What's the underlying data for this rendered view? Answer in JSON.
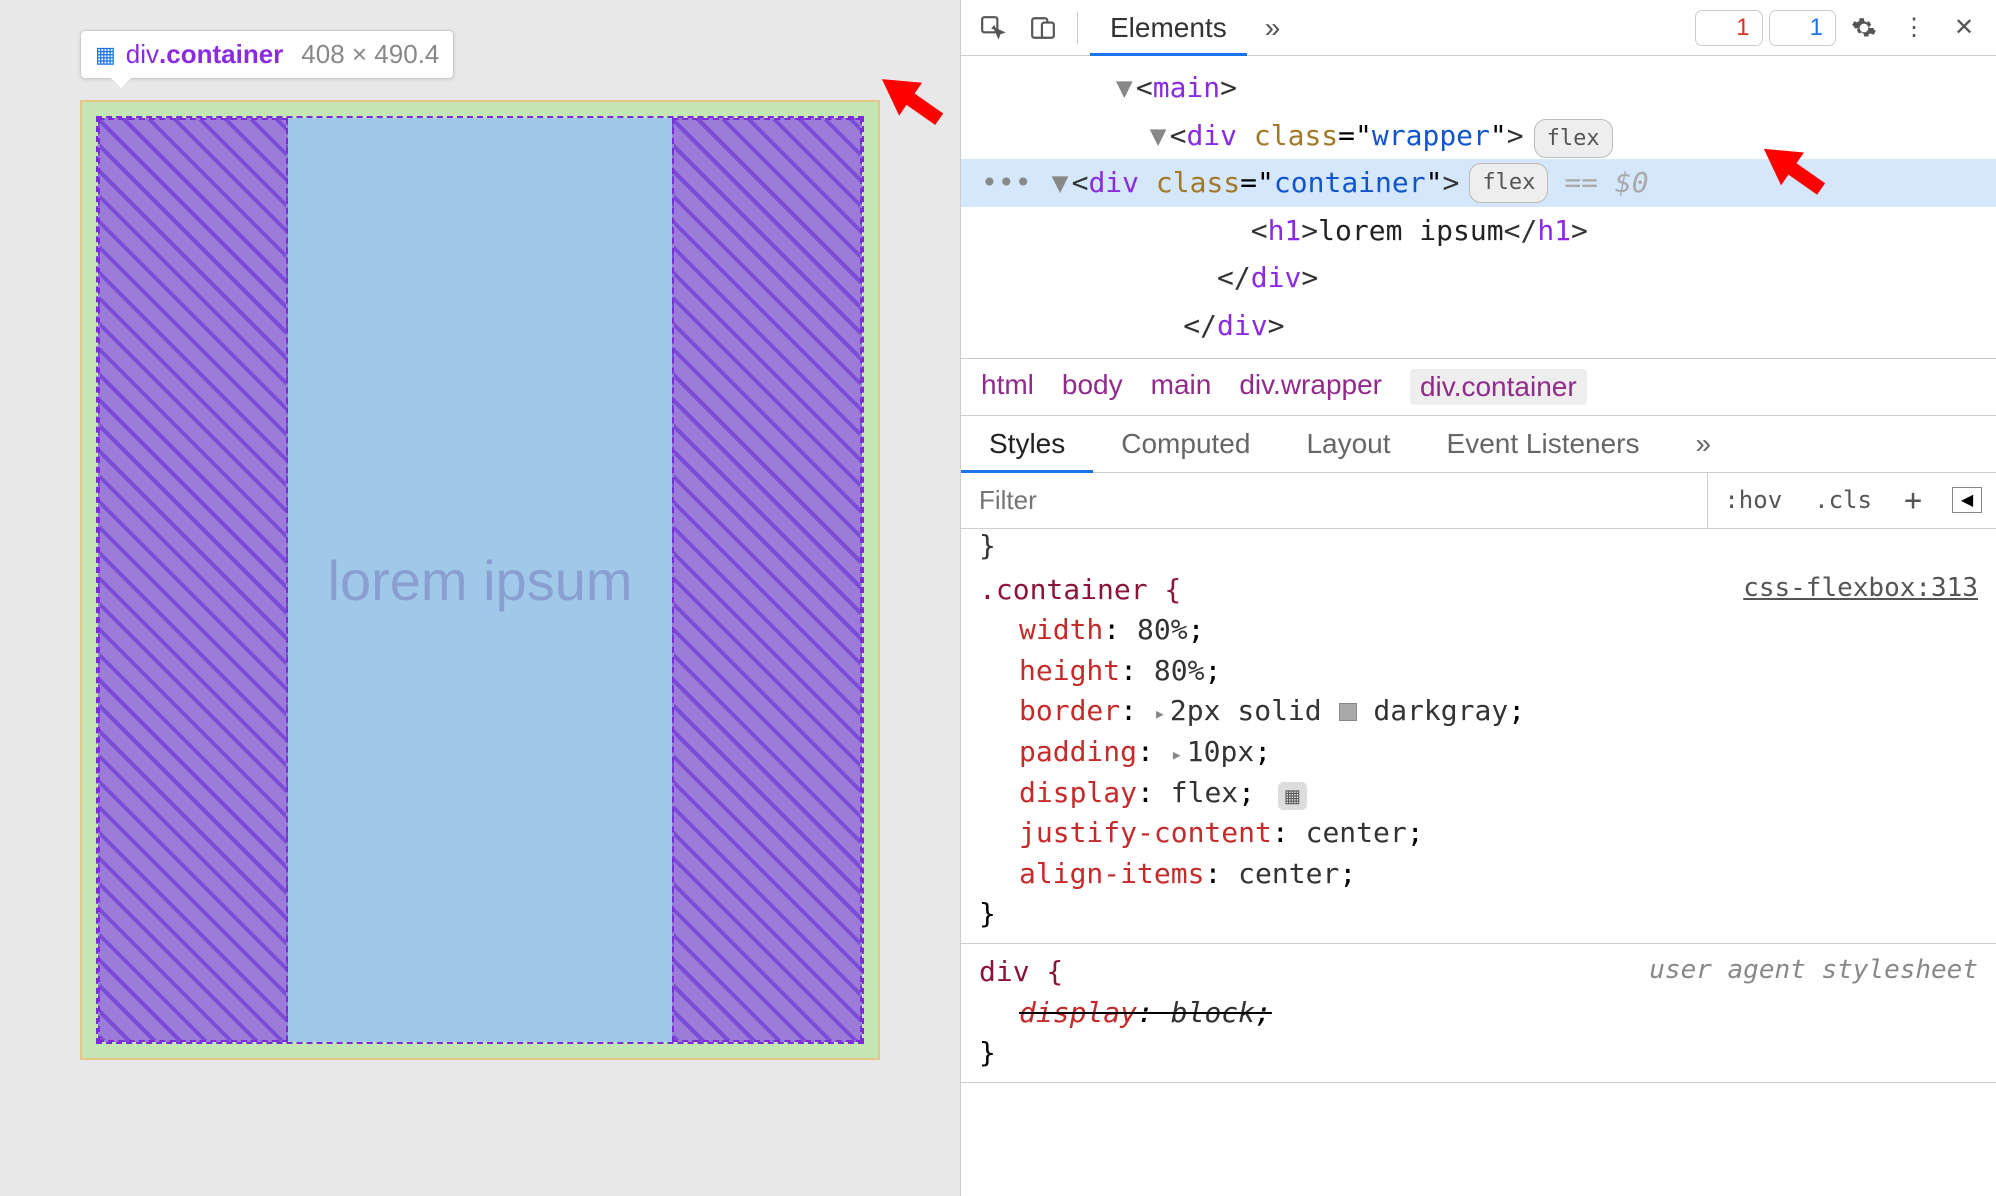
{
  "tooltip": {
    "tag": "div",
    "class": ".container",
    "dims": "408 × 490.4"
  },
  "preview": {
    "heading": "lorem ipsum"
  },
  "toolbar": {
    "tab_elements": "Elements",
    "error_count": "1",
    "info_count": "1"
  },
  "dom": {
    "main": "<main>",
    "wrapper_open": "<div class=\"wrapper\">",
    "wrapper_badge": "flex",
    "container_open": "<div class=\"container\">",
    "container_badge": "flex",
    "eqdollar": "== $0",
    "h1": "<h1>lorem ipsum</h1>",
    "div_close1": "</div>",
    "div_close2": "</div>"
  },
  "crumbs": {
    "c1": "html",
    "c2": "body",
    "c3": "main",
    "c4": "div.wrapper",
    "c5": "div.container"
  },
  "subtabs": {
    "styles": "Styles",
    "computed": "Computed",
    "layout": "Layout",
    "events": "Event Listeners"
  },
  "filter": {
    "placeholder": "Filter",
    "hov": ":hov",
    "cls": ".cls"
  },
  "rules": {
    "r1": {
      "source": "css-flexbox:313",
      "selector": ".container {",
      "p_width": "width",
      "v_width": "80%",
      "p_height": "height",
      "v_height": "80%",
      "p_border": "border",
      "v_border": "2px solid ",
      "v_border_color": "darkgray",
      "p_padding": "padding",
      "v_padding": "10px",
      "p_display": "display",
      "v_display": "flex",
      "p_jc": "justify-content",
      "v_jc": "center",
      "p_ai": "align-items",
      "v_ai": "center",
      "close": "}"
    },
    "r2": {
      "source": "user agent stylesheet",
      "selector": "div {",
      "p_display": "display",
      "v_display": "block",
      "close": "}"
    }
  }
}
